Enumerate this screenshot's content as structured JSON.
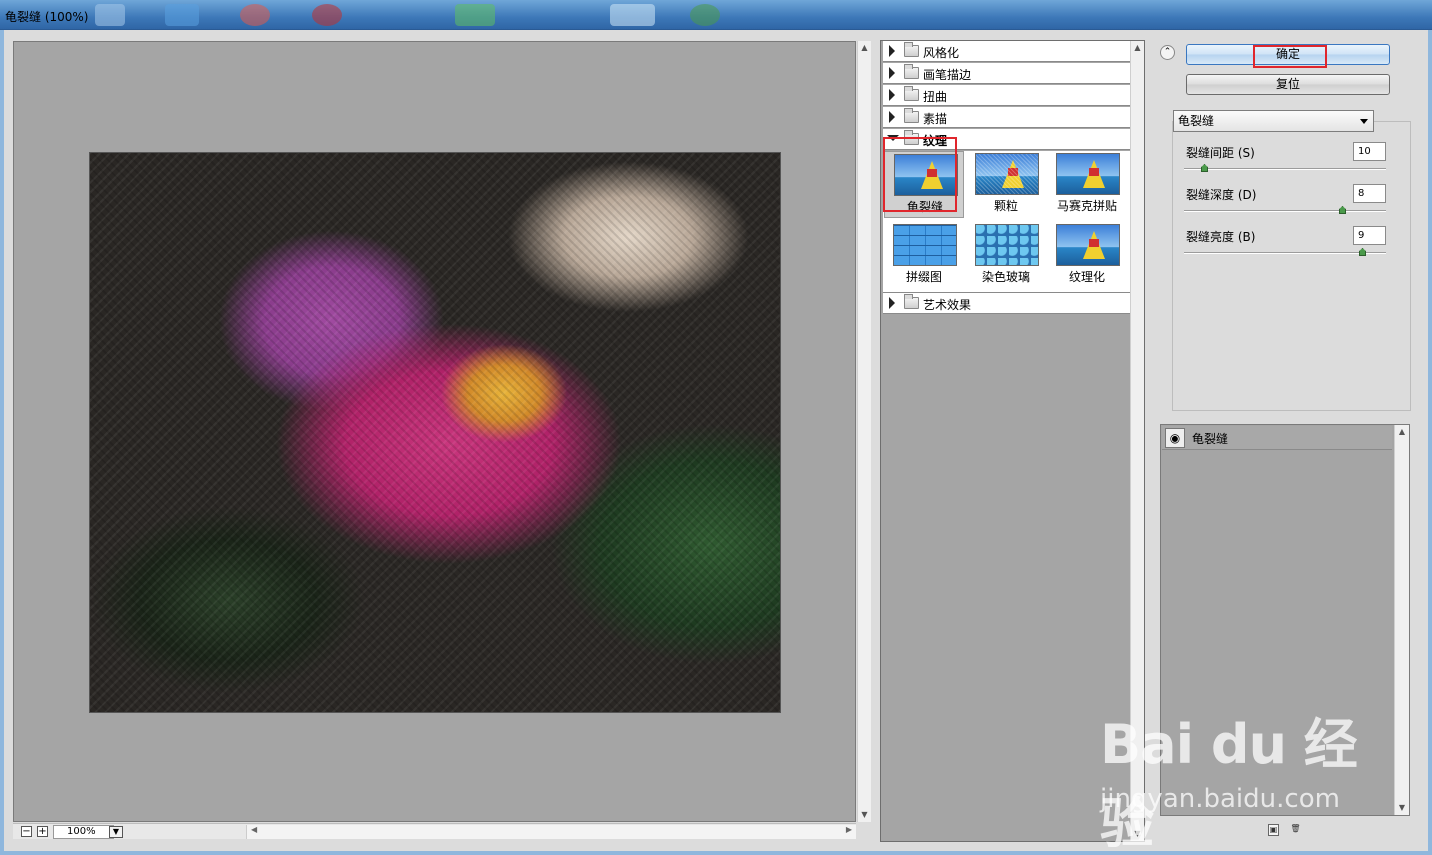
{
  "window": {
    "title": "龟裂缝 (100%)"
  },
  "preview": {
    "zoom_value": "100%",
    "minus": "−",
    "plus": "+"
  },
  "gallery": {
    "categories": [
      {
        "label": "风格化"
      },
      {
        "label": "画笔描边"
      },
      {
        "label": "扭曲"
      },
      {
        "label": "素描"
      },
      {
        "label": "纹理"
      },
      {
        "label": "艺术效果"
      }
    ],
    "thumbnails": [
      {
        "label": "龟裂缝"
      },
      {
        "label": "颗粒"
      },
      {
        "label": "马赛克拼贴"
      },
      {
        "label": "拼缀图"
      },
      {
        "label": "染色玻璃"
      },
      {
        "label": "纹理化"
      }
    ]
  },
  "actions": {
    "ok_label": "确定",
    "reset_label": "复位"
  },
  "filter": {
    "selected": "龟裂缝",
    "params": [
      {
        "label": "裂缝间距 (S)",
        "value": "10",
        "fraction": 0.09
      },
      {
        "label": "裂缝深度 (D)",
        "value": "8",
        "fraction": 0.8
      },
      {
        "label": "裂缝亮度 (B)",
        "value": "9",
        "fraction": 0.9
      }
    ]
  },
  "layers": {
    "items": [
      {
        "name": "龟裂缝"
      }
    ]
  },
  "watermark": {
    "brand": "Bai du 经验",
    "url": "jingyan.baidu.com"
  }
}
